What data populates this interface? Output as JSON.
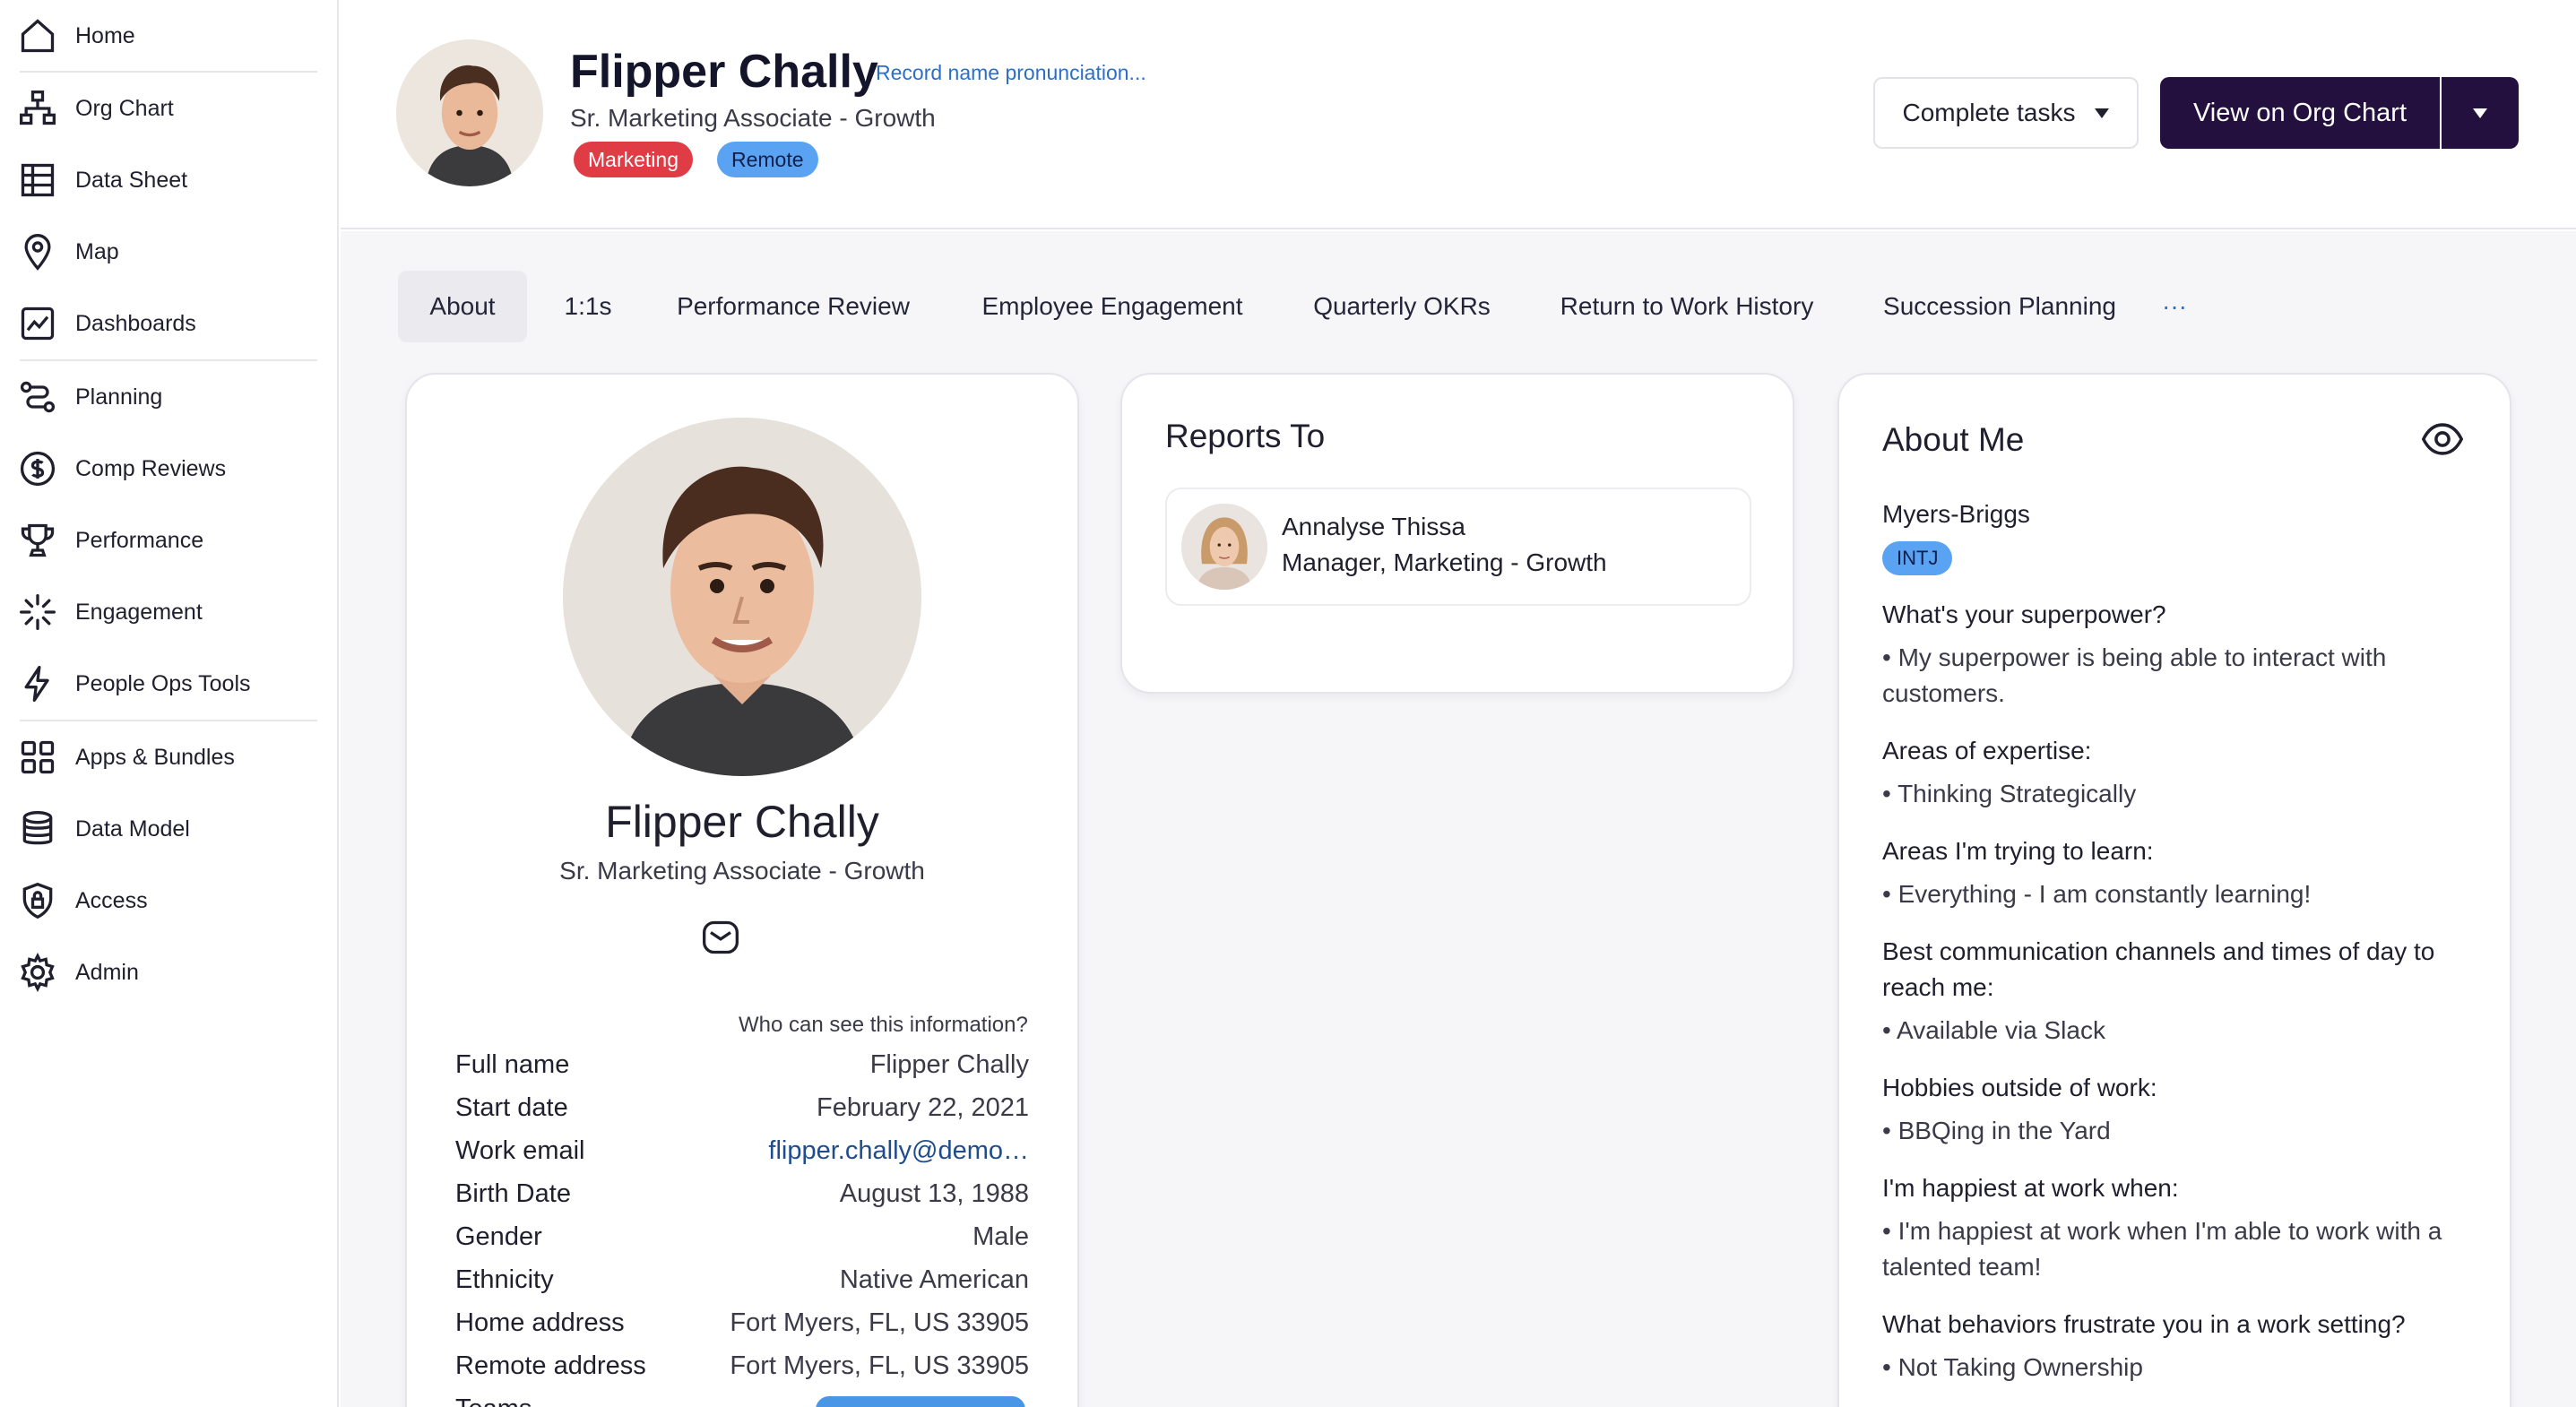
{
  "sidebar": {
    "items": [
      {
        "label": "Home",
        "icon": "home-icon"
      },
      {
        "label": "Org Chart",
        "icon": "org-chart-icon"
      },
      {
        "label": "Data Sheet",
        "icon": "table-icon"
      },
      {
        "label": "Map",
        "icon": "map-pin-icon"
      },
      {
        "label": "Dashboards",
        "icon": "dashboard-icon"
      },
      {
        "label": "Planning",
        "icon": "planning-icon"
      },
      {
        "label": "Comp Reviews",
        "icon": "dollar-icon"
      },
      {
        "label": "Performance",
        "icon": "trophy-icon"
      },
      {
        "label": "Engagement",
        "icon": "burst-icon"
      },
      {
        "label": "People Ops Tools",
        "icon": "lightning-icon"
      },
      {
        "label": "Apps & Bundles",
        "icon": "apps-grid-icon"
      },
      {
        "label": "Data Model",
        "icon": "database-icon"
      },
      {
        "label": "Access",
        "icon": "shield-lock-icon"
      },
      {
        "label": "Admin",
        "icon": "gear-icon"
      }
    ]
  },
  "header": {
    "name": "Flipper Chally",
    "record_pronunciation": "Record name pronunciation...",
    "title": "Sr. Marketing Associate - Growth",
    "tags": [
      "Marketing",
      "Remote"
    ],
    "complete_tasks": "Complete tasks",
    "view_org_chart": "View on Org Chart"
  },
  "tabs": [
    "About",
    "1:1s",
    "Performance Review",
    "Employee Engagement",
    "Quarterly OKRs",
    "Return to Work History",
    "Succession Planning",
    "···"
  ],
  "profile": {
    "name": "Flipper Chally",
    "title": "Sr. Marketing Associate - Growth",
    "who_can_see": "Who can see this information?",
    "fields": [
      {
        "key": "Full name",
        "value": "Flipper Chally"
      },
      {
        "key": "Start date",
        "value": "February 22, 2021"
      },
      {
        "key": "Work email",
        "value": "flipper.chally@demo…"
      },
      {
        "key": "Birth Date",
        "value": "August 13, 1988"
      },
      {
        "key": "Gender",
        "value": "Male"
      },
      {
        "key": "Ethnicity",
        "value": "Native American"
      },
      {
        "key": "Home address",
        "value": "Fort Myers, FL, US 33905"
      },
      {
        "key": "Remote address",
        "value": "Fort Myers, FL, US 33905"
      },
      {
        "key": "Teams",
        "value": ""
      }
    ]
  },
  "reports_to": {
    "title": "Reports To",
    "name": "Annalyse Thissa",
    "role": "Manager, Marketing - Growth"
  },
  "about_me": {
    "title": "About Me",
    "mbti_label": "Myers-Briggs",
    "mbti": "INTJ",
    "qa": [
      {
        "q": "What's your superpower?",
        "a": "• My superpower is being able to interact with customers."
      },
      {
        "q": "Areas of expertise:",
        "a": "• Thinking Strategically"
      },
      {
        "q": "Areas I'm trying to learn:",
        "a": "• Everything - I am constantly learning!"
      },
      {
        "q": "Best communication channels and times of day to reach me:",
        "a": "• Available via Slack"
      },
      {
        "q": "Hobbies outside of work:",
        "a": "• BBQing in the Yard"
      },
      {
        "q": "I'm happiest at work when:",
        "a": "• I'm happiest at work when I'm able to work with a talented team!"
      },
      {
        "q": "What behaviors frustrate you in a work setting?",
        "a": "• Not Taking Ownership"
      }
    ]
  },
  "colors": {
    "accent_dark": "#24103e",
    "tag_marketing": "#e03c45",
    "tag_remote": "#5aa2f2",
    "link": "#2b6fc9"
  }
}
